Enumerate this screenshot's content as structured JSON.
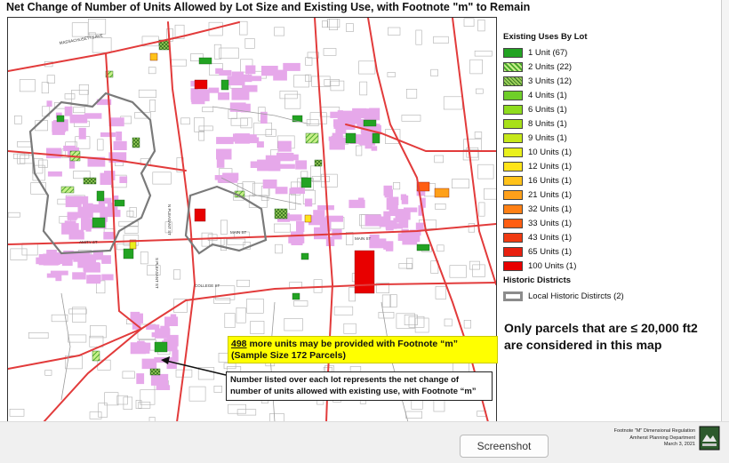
{
  "title": {
    "prefix": "Net Change of Number of Units Allowed by Lot Size and ",
    "emphasis": "Existing",
    "suffix": " Use, with Footnote \"m\" to Remain"
  },
  "legend": {
    "heading": "Existing Uses By Lot",
    "items": [
      {
        "label": "1 Unit (67)",
        "color": "#22a322",
        "pattern": "solid"
      },
      {
        "label": "2 Units (22)",
        "color": "#7ed321",
        "pattern": "hatch"
      },
      {
        "label": "3 Units (12)",
        "color": "#5aa02c",
        "pattern": "crosshatch"
      },
      {
        "label": "4 Units (1)",
        "color": "#6fce29",
        "pattern": "solid"
      },
      {
        "label": "6 Units (1)",
        "color": "#8fdc1e",
        "pattern": "solid"
      },
      {
        "label": "8 Units (1)",
        "color": "#a8e01a",
        "pattern": "solid"
      },
      {
        "label": "9 Units (1)",
        "color": "#c6e81a",
        "pattern": "solid"
      },
      {
        "label": "10 Units (1)",
        "color": "#e9f01c",
        "pattern": "solid"
      },
      {
        "label": "12 Units (1)",
        "color": "#ffe419",
        "pattern": "solid"
      },
      {
        "label": "16 Units (1)",
        "color": "#ffc21a",
        "pattern": "solid"
      },
      {
        "label": "21 Units (1)",
        "color": "#ffa01a",
        "pattern": "solid"
      },
      {
        "label": "32 Units (1)",
        "color": "#ff8015",
        "pattern": "solid"
      },
      {
        "label": "33 Units (1)",
        "color": "#ff5e12",
        "pattern": "solid"
      },
      {
        "label": "43 Units (1)",
        "color": "#f03a12",
        "pattern": "solid"
      },
      {
        "label": "65 Units (1)",
        "color": "#e8200f",
        "pattern": "solid"
      },
      {
        "label": "100 Units (1)",
        "color": "#e80000",
        "pattern": "solid"
      }
    ],
    "historic_heading": "Historic Districts",
    "historic_item": "Local Historic Distircts (2)"
  },
  "note": "Only parcels that are ≤ 20,000 ft2 are considered in this map",
  "callout_yellow": {
    "number": "498",
    "text": " more units may be provided with Footnote “m” (Sample Size 172 Parcels)"
  },
  "callout_box": "Number listed over each lot represents the net change of number of units allowed with existing use, with Footnote “m”",
  "map_labels": {
    "massachusetts_ave": "MASSACHUSETTS AVE",
    "main_st": "MAIN ST",
    "college_st": "COLLEGE ST",
    "amity_st": "AMITY ST",
    "n_pleasant_st": "N PLEASANT ST",
    "s_pleasant_st": "S PLEASANT ST"
  },
  "footer": {
    "line1": "Footnote \"M\" Dimensional Regulation",
    "line2": "Amherst Planning Department",
    "line3": "March 3, 2021"
  },
  "screenshot_label": "Screenshot",
  "colors": {
    "parcel_pink": "#e6a8ea",
    "road_red": "#e23b3b",
    "parcel_outline": "#9a9a9a",
    "historic_outline": "#7a7a7a"
  }
}
